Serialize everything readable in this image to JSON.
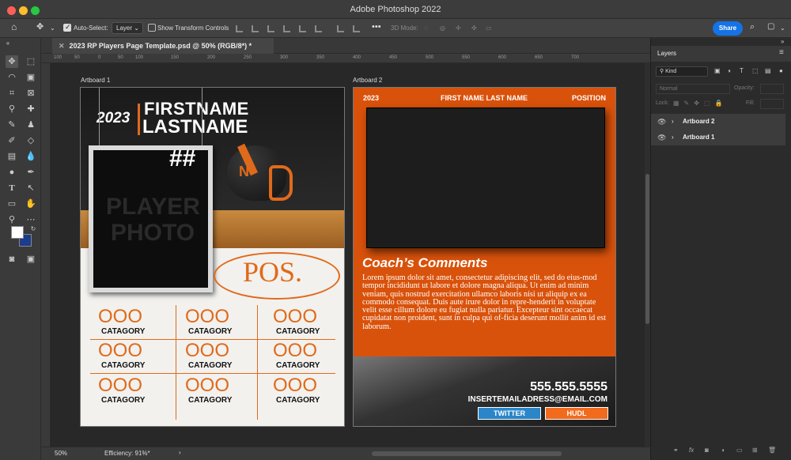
{
  "window": {
    "title": "Adobe Photoshop 2022"
  },
  "options_bar": {
    "auto_select_label": "Auto-Select:",
    "auto_select_value": "Layer",
    "show_transform_label": "Show Transform Controls",
    "three_d_mode_label": "3D Mode:",
    "share_label": "Share"
  },
  "document": {
    "tab_title": "2023 RP Players Page Template.psd @ 50% (RGB/8*) *",
    "artboard1_label": "Artboard 1",
    "artboard2_label": "Artboard 2"
  },
  "ruler": {
    "top_ticks": [
      "100",
      "50",
      "0",
      "50",
      "100",
      "150",
      "200",
      "250",
      "300",
      "350",
      "400",
      "450",
      "500",
      "550",
      "600",
      "650",
      "700"
    ]
  },
  "artboard1": {
    "year": "2023",
    "first_name": "FIRSTNAME",
    "last_name": "LASTNAME",
    "number": "##",
    "photo_line1": "PLAYER",
    "photo_line2": "PHOTO",
    "position": "POS.",
    "stats": [
      {
        "value": "OOO",
        "label": "CATAGORY"
      },
      {
        "value": "OOO",
        "label": "CATAGORY"
      },
      {
        "value": "OOO",
        "label": "CATAGORY"
      },
      {
        "value": "OOO",
        "label": "CATAGORY"
      },
      {
        "value": "OOO",
        "label": "CATAGORY"
      },
      {
        "value": "OOO",
        "label": "CATAGORY"
      },
      {
        "value": "OOO",
        "label": "CATAGORY"
      },
      {
        "value": "OOO",
        "label": "CATAGORY"
      },
      {
        "value": "OOO",
        "label": "CATAGORY"
      }
    ]
  },
  "artboard2": {
    "year": "2023",
    "name": "FIRST NAME LAST NAME",
    "position": "POSITION",
    "comments_title": "Coach’s Comments",
    "comments_body": "Lorem ipsum dolor sit amet, consectetur adipiscing elit, sed do eius-mod tempor incididunt ut labore et dolore magna aliqua. Ut enim ad minim veniam, quis nostrud exercitation ullamco laboris nisi ut aliquip ex ea commodo consequat. Duis aute irure dolor in repre-henderit in voluptate velit esse cillum dolore eu fugiat nulla pariatur. Excepteur sint occaecat cupidatat non proident, sunt in culpa qui of-ficia deserunt mollit anim id est laborum.",
    "phone": "555.555.5555",
    "email": "INSERTEMAILADRESS@EMAIL.COM",
    "twitter_label": "TWITTER",
    "hudl_label": "HUDL"
  },
  "status_bar": {
    "zoom": "50%",
    "efficiency": "Efficiency: 91%*"
  },
  "layers_panel": {
    "tab_title": "Layers",
    "filter_kind": "Kind",
    "blend_mode": "Normal",
    "opacity_label": "Opacity:",
    "lock_label": "Lock:",
    "fill_label": "Fill:",
    "layers": [
      {
        "name": "Artboard 2"
      },
      {
        "name": "Artboard 1"
      }
    ]
  },
  "colors": {
    "accent_orange": "#e06a1b",
    "share_blue": "#1473e6",
    "twitter_blue": "#2a86c9",
    "hudl_orange": "#f26b1d"
  }
}
